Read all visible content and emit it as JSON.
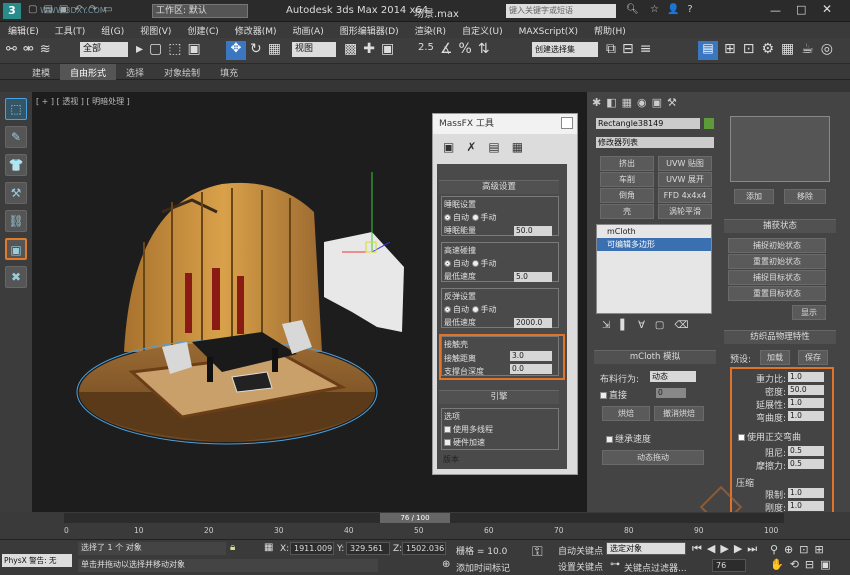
{
  "window": {
    "title": "Autodesk 3ds Max  2014 x64",
    "file": "场景.max",
    "workspace": "工作区: 默认",
    "search_placeholder": "键入关键字或短语",
    "watermark": "WWW.3DXY.COM"
  },
  "menu": [
    "编辑(E)",
    "工具(T)",
    "组(G)",
    "视图(V)",
    "创建(C)",
    "修改器(M)",
    "动画(A)",
    "图形编辑器(D)",
    "渲染(R)",
    "自定义(U)",
    "MAXScript(X)",
    "帮助(H)"
  ],
  "toolbar": {
    "filter": "全部",
    "view": "视图",
    "snap": "2.5",
    "selection_set": "创建选择集"
  },
  "ribbon": {
    "tabs": [
      "建模",
      "自由形式",
      "选择",
      "对象绘制",
      "填充"
    ],
    "active": 1
  },
  "viewport": {
    "label": "[ + ] [ 透视 ] [ 明暗处理 ]"
  },
  "massfx": {
    "title": "MassFX 工具",
    "section": "高级设置",
    "sleep": {
      "title": "睡眠设置",
      "auto": "自动",
      "manual": "手动",
      "energy_label": "睡眠能量",
      "energy": "50.0"
    },
    "collision": {
      "title": "高速碰撞",
      "auto": "自动",
      "manual": "手动",
      "speed_label": "最低速度",
      "speed": "5.0"
    },
    "bounce": {
      "title": "反弹设置",
      "auto": "自动",
      "manual": "手动",
      "speed_label": "最低速度",
      "speed": "2000.0"
    },
    "contact": {
      "title": "接触壳",
      "dist_label": "接触距离",
      "dist": "3.0",
      "depth_label": "支撑台深度",
      "depth": "0.0"
    },
    "engine": "引擎",
    "options": {
      "title": "选项",
      "multithread": "使用多线程",
      "hardware": "硬件加速"
    },
    "version": "版本"
  },
  "cmd": {
    "object_name": "Rectangle38149",
    "modifier_list": "修改器列表",
    "mod_buttons": [
      "挤出",
      "UVW 贴图",
      "车削",
      "UVW 展开",
      "倒角",
      "FFD 4x4x4",
      "壳",
      "涡轮平滑"
    ],
    "stack": [
      "mCloth",
      "可编辑多边形"
    ],
    "mcloth": {
      "title": "mCloth 模拟",
      "behavior_label": "布料行为:",
      "behavior": "动态",
      "direct": "直接",
      "direct_val": "0",
      "bake": "烘焙",
      "undo_bake": "撤消烘焙",
      "inherit": "继承速度",
      "sim": "动态拖动"
    }
  },
  "right": {
    "add": "添加",
    "remove": "移除",
    "capture": {
      "title": "捕获状态",
      "buttons": [
        "捕捉初始状态",
        "重置初始状态",
        "捕捉目标状态",
        "重置目标状态"
      ],
      "show": "显示"
    },
    "props": {
      "title": "纺织品物理特性",
      "preset_label": "预设:",
      "load": "加载",
      "save": "保存",
      "rows": [
        {
          "label": "重力比:",
          "value": "1.0"
        },
        {
          "label": "密度:",
          "value": "50.0"
        },
        {
          "label": "延展性:",
          "value": "1.0"
        },
        {
          "label": "弯曲度:",
          "value": "1.0"
        }
      ],
      "ortho": "使用正交弯曲",
      "damp": [
        {
          "label": "阻尼:",
          "value": "0.5"
        },
        {
          "label": "摩擦力:",
          "value": "0.5"
        }
      ],
      "compress": "压缩",
      "limit": [
        {
          "label": "限制:",
          "value": "1.0"
        },
        {
          "label": "刚度:",
          "value": "1.0"
        }
      ]
    }
  },
  "timeline": {
    "frame": "76 / 100",
    "ticks": [
      "0",
      "10",
      "20",
      "30",
      "40",
      "50",
      "60",
      "70",
      "80",
      "90",
      "100"
    ]
  },
  "status": {
    "physx": "PhysX 警告: 无",
    "selected": "选择了 1 个 对象",
    "hint": "单击并拖动以选择并移动对象",
    "x_label": "X:",
    "x": "1911.009",
    "y_label": "Y:",
    "y": "329.561",
    "z_label": "Z:",
    "z": "1502.036",
    "grid": "栅格 = 10.0",
    "auto_key": "自动关键点",
    "set_key": "设置关键点",
    "key_mode": "选定对象",
    "key_filter": "关键点过滤器...",
    "add_tag": "添加时间标记",
    "frame": "76"
  }
}
